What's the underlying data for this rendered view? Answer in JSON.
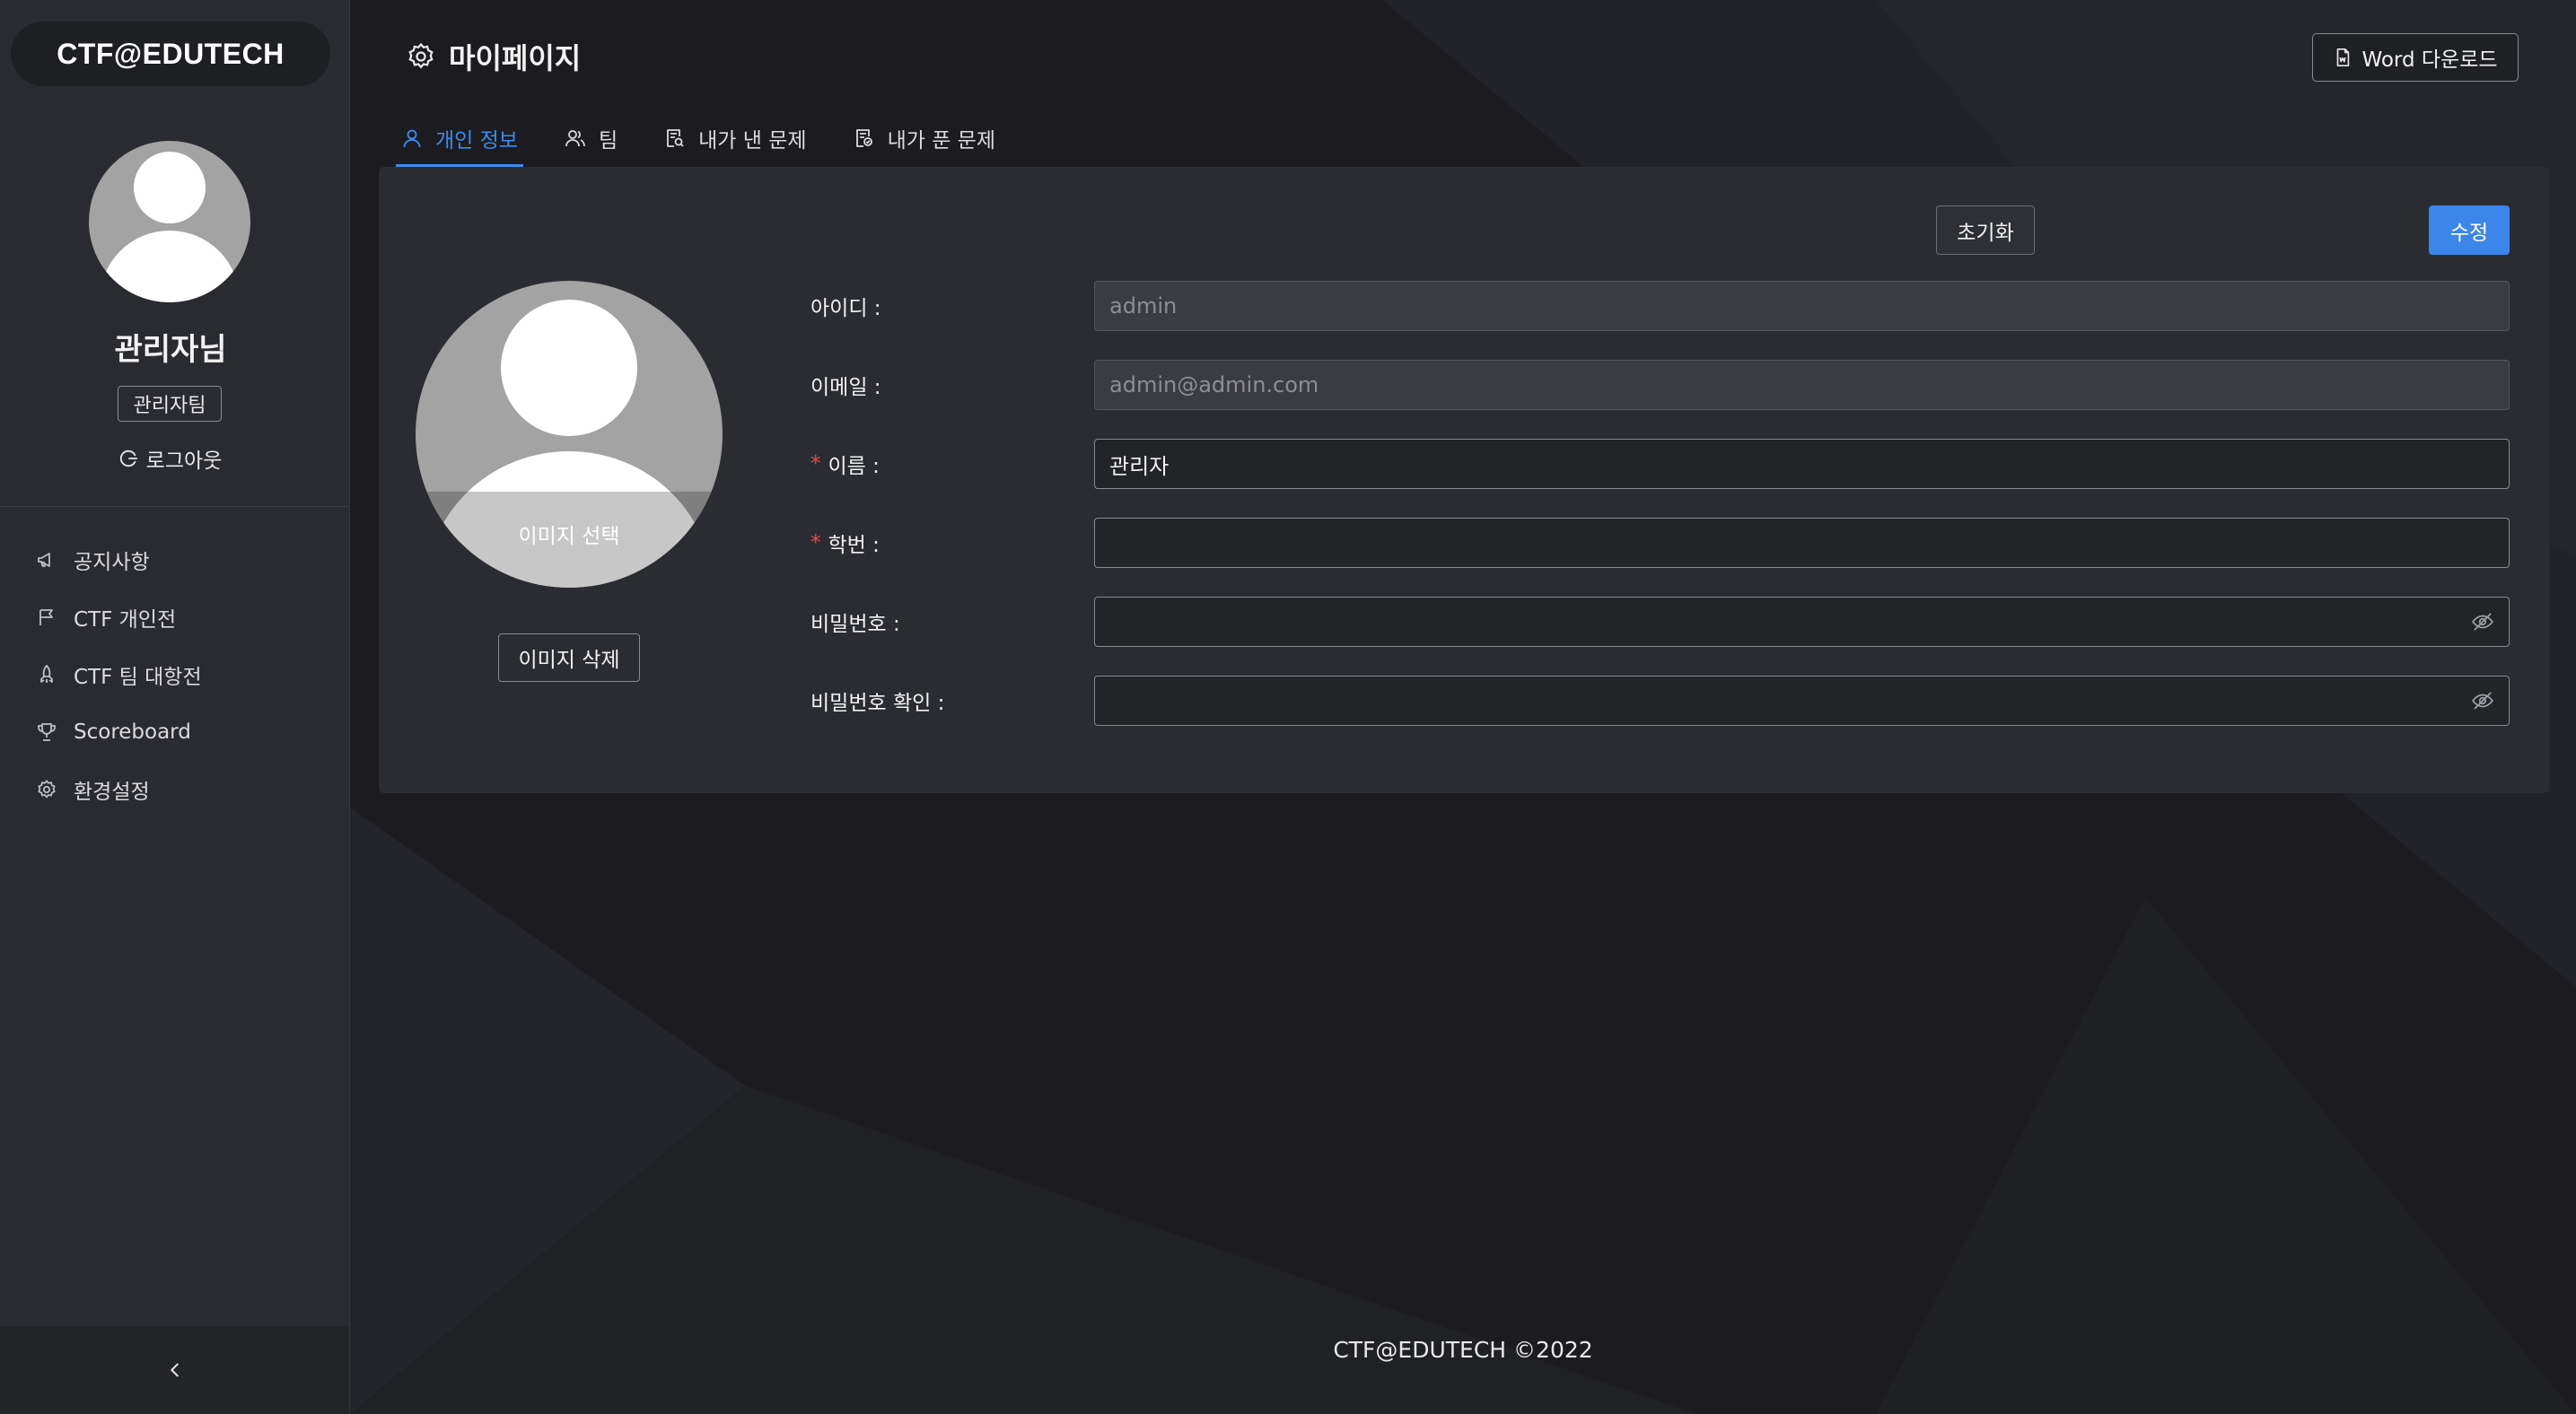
{
  "sidebar": {
    "brand": "CTF@EDUTECH",
    "user_name": "관리자님",
    "team_badge": "관리자팀",
    "logout_label": "로그아웃",
    "menu": [
      {
        "label": "공지사항",
        "icon": "megaphone-icon"
      },
      {
        "label": "CTF 개인전",
        "icon": "flag-icon"
      },
      {
        "label": "CTF 팀 대항전",
        "icon": "rocket-icon"
      },
      {
        "label": "Scoreboard",
        "icon": "trophy-icon"
      },
      {
        "label": "환경설정",
        "icon": "gear-icon"
      }
    ],
    "collapse_icon": "chevron-left-icon"
  },
  "header": {
    "title": "마이페이지",
    "title_icon": "gear-icon",
    "download_button": "Word 다운로드",
    "download_icon": "document-icon"
  },
  "tabs": [
    {
      "label": "개인 정보",
      "icon": "user-icon",
      "active": true
    },
    {
      "label": "팀",
      "icon": "team-icon",
      "active": false
    },
    {
      "label": "내가 낸 문제",
      "icon": "file-search-icon",
      "active": false
    },
    {
      "label": "내가 푼 문제",
      "icon": "file-check-icon",
      "active": false
    }
  ],
  "profile": {
    "reset_button": "초기화",
    "edit_button": "수정",
    "select_image_label": "이미지 선택",
    "delete_image_button": "이미지 삭제",
    "fields": {
      "id": {
        "label": "아이디 :",
        "value": "admin",
        "required": false,
        "disabled": true
      },
      "email": {
        "label": "이메일 :",
        "value": "admin@admin.com",
        "required": false,
        "disabled": true
      },
      "name": {
        "label": "이름 :",
        "value": "관리자",
        "required": true,
        "disabled": false
      },
      "student_id": {
        "label": "학번 :",
        "value": "",
        "required": true,
        "disabled": false
      },
      "password": {
        "label": "비밀번호 :",
        "value": "",
        "required": false,
        "disabled": false
      },
      "password_confirm": {
        "label": "비밀번호 확인 :",
        "value": "",
        "required": false,
        "disabled": false
      }
    },
    "required_mark": "*",
    "password_toggle_icon": "eye-invisible-icon"
  },
  "footer": {
    "text": "CTF@EDUTECH ©2022"
  },
  "colors": {
    "accent": "#3b8cf0",
    "primary_button": "#3b86e8",
    "required": "#e5484d",
    "background": "#1d1d21",
    "sidebar": "#2a2b30",
    "card": "#2b2c31"
  }
}
